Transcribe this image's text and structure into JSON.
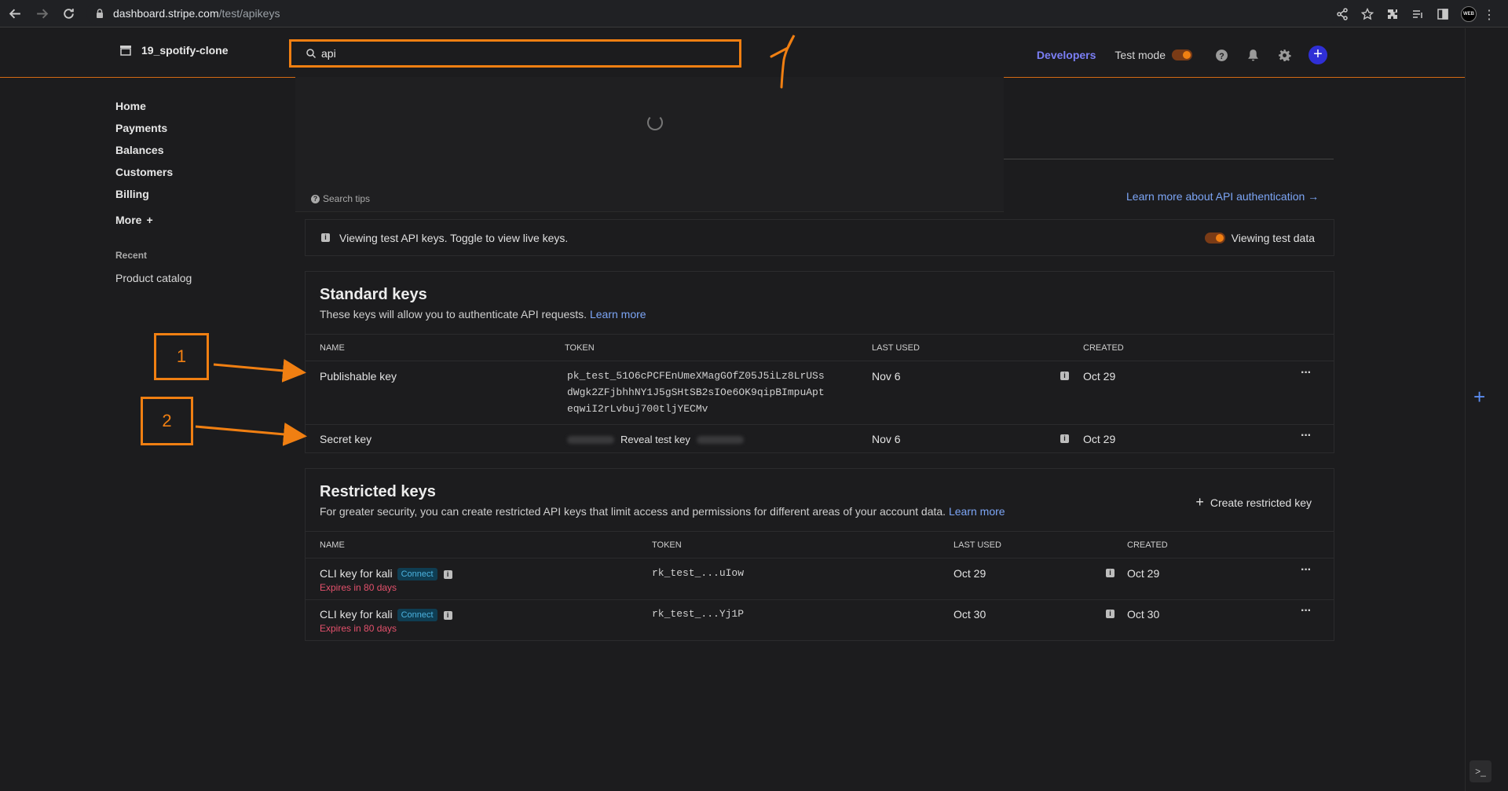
{
  "browser": {
    "url_host": "dashboard.stripe.com",
    "url_path": "/test/apikeys",
    "profile_badge": "WEB"
  },
  "topbar": {
    "account_name": "19_spotify-clone",
    "search_value": "api",
    "developers": "Developers",
    "test_mode": "Test mode"
  },
  "sidebar": {
    "items": [
      "Home",
      "Payments",
      "Balances",
      "Customers",
      "Billing"
    ],
    "more": "More",
    "recent_label": "Recent",
    "recent_items": [
      "Product catalog"
    ]
  },
  "search_dropdown": {
    "tips": "Search tips"
  },
  "header": {
    "learn_auth": "Learn more about API authentication →"
  },
  "notice": {
    "text": "Viewing test API keys. Toggle to view live keys.",
    "toggle_label": "Viewing test data"
  },
  "standard_keys": {
    "title": "Standard keys",
    "description": "These keys will allow you to authenticate API requests.",
    "learn_more": "Learn more",
    "columns": [
      "NAME",
      "TOKEN",
      "LAST USED",
      "CREATED"
    ],
    "rows": [
      {
        "name": "Publishable key",
        "token_lines": [
          "pk_test_51O6cPCFEnUmeXMagGOfZ05J5iLz8LrUSs",
          "dWgk2ZFjbhhNY1J5gSHtSB2sIOe6OK9qipBImpuApt",
          "eqwiI2rLvbuj700tljYECMv"
        ],
        "last_used": "Nov 6",
        "created": "Oct 29"
      },
      {
        "name": "Secret key",
        "reveal": "Reveal test key",
        "last_used": "Nov 6",
        "created": "Oct 29"
      }
    ]
  },
  "restricted_keys": {
    "title": "Restricted keys",
    "description": "For greater security, you can create restricted API keys that limit access and permissions for different areas of your account data.",
    "learn_more": "Learn more",
    "create": "Create restricted key",
    "columns": [
      "NAME",
      "TOKEN",
      "LAST USED",
      "CREATED"
    ],
    "rows": [
      {
        "name": "CLI key for kali",
        "badge": "Connect",
        "expires": "Expires in 80 days",
        "token": "rk_test_...uIow",
        "last_used": "Oct 29",
        "created": "Oct 29"
      },
      {
        "name": "CLI key for kali",
        "badge": "Connect",
        "expires": "Expires in 80 days",
        "token": "rk_test_...Yj1P",
        "last_used": "Oct 30",
        "created": "Oct 30"
      }
    ]
  },
  "annotations": {
    "box1": "1",
    "box2": "2"
  },
  "colors": {
    "annotation": "#f07f12",
    "accent_link": "#7ca5f5",
    "developers": "#7b7ff6",
    "expires": "#e4516c"
  }
}
